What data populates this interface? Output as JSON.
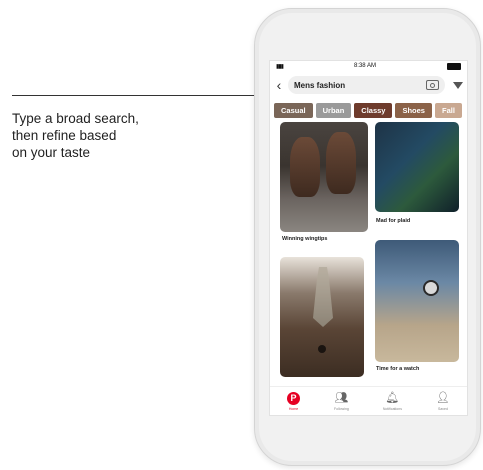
{
  "callout": {
    "line1": "Type a broad search,",
    "line2": "then refine based",
    "line3": "on your taste"
  },
  "status": {
    "time": "8:38 AM"
  },
  "search": {
    "query": "Mens fashion",
    "back_icon": "chevron-left-icon",
    "camera_icon": "camera-icon",
    "filter_icon": "filter-icon"
  },
  "chips": [
    {
      "label": "Casual",
      "color": "#7a6658"
    },
    {
      "label": "Urban",
      "color": "#9a9a9a"
    },
    {
      "label": "Classy",
      "color": "#6e3b2c"
    },
    {
      "label": "Shoes",
      "color": "#8b6248"
    },
    {
      "label": "Fall",
      "color": "#c9a891"
    }
  ],
  "pins": [
    {
      "caption": "Winning wingtips"
    },
    {
      "caption": "Mad for plaid"
    },
    {
      "caption": "Time for a watch"
    }
  ],
  "tabs": [
    {
      "label": "Home",
      "icon": "pinterest-logo-icon"
    },
    {
      "label": "Following",
      "icon": "people-icon"
    },
    {
      "label": "Notifications",
      "icon": "bell-icon"
    },
    {
      "label": "Saved",
      "icon": "person-icon"
    }
  ],
  "brand_color": "#e60023"
}
